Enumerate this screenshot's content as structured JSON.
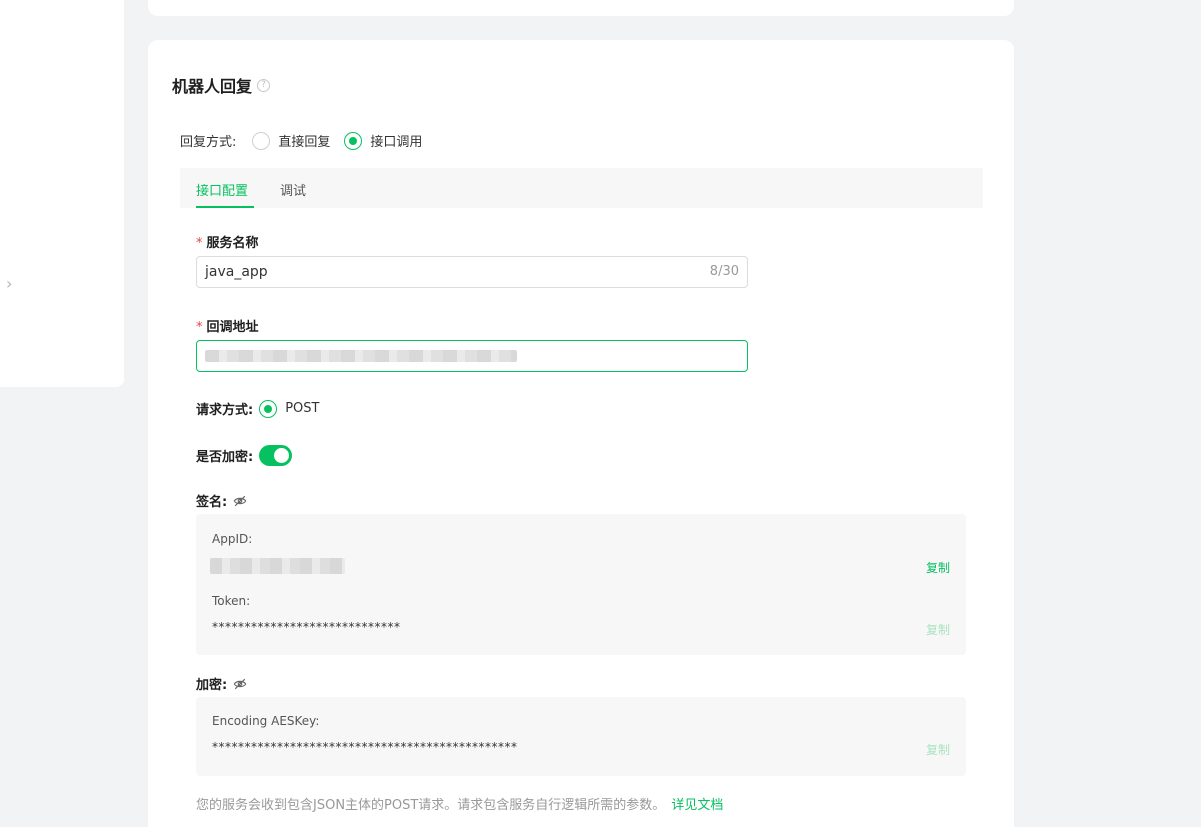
{
  "section": {
    "title": "机器人回复",
    "help_icon": "?"
  },
  "reply_mode": {
    "label": "回复方式:",
    "options": [
      {
        "label": "直接回复",
        "checked": false
      },
      {
        "label": "接口调用",
        "checked": true
      }
    ]
  },
  "tabs": [
    {
      "label": "接口配置",
      "active": true
    },
    {
      "label": "调试",
      "active": false
    }
  ],
  "service_name": {
    "required_mark": "*",
    "label": "服务名称",
    "value": "java_app",
    "counter": "8/30"
  },
  "callback_url": {
    "required_mark": "*",
    "label": "回调地址"
  },
  "request_method": {
    "label": "请求方式:",
    "option": "POST"
  },
  "encryption_toggle": {
    "label": "是否加密:",
    "on": true
  },
  "signature": {
    "label": "签名:",
    "appid_label": "AppID:",
    "token_label": "Token:",
    "token_value": "*****************************",
    "copy": "复制"
  },
  "encryption": {
    "label": "加密:",
    "key_label": "Encoding AESKey:",
    "key_value": "***********************************************",
    "copy": "复制"
  },
  "footer": {
    "note": "您的服务会收到包含JSON主体的POST请求。请求包含服务自行逻辑所需的参数。",
    "link": "详见文档"
  },
  "colors": {
    "accent": "#07c160",
    "required": "#e54545"
  }
}
